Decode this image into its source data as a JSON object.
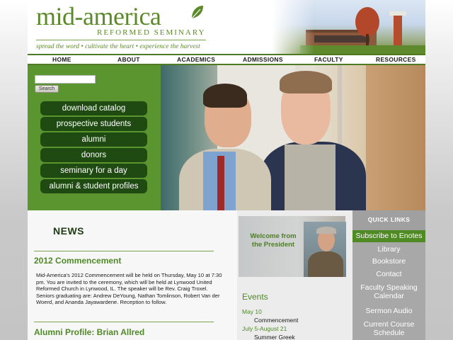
{
  "header": {
    "logo_main": "mid-america",
    "logo_sub": "REFORMED SEMINARY",
    "tagline": "spread the word • cultivate the heart • experience the harvest"
  },
  "nav": {
    "items": [
      {
        "label": "HOME"
      },
      {
        "label": "ABOUT"
      },
      {
        "label": "ACADEMICS"
      },
      {
        "label": "ADMISSIONS"
      },
      {
        "label": "FACULTY"
      },
      {
        "label": "RESOURCES"
      }
    ]
  },
  "search": {
    "value": "",
    "button_label": "Search"
  },
  "quick_buttons": [
    {
      "label": "download catalog"
    },
    {
      "label": "prospective students"
    },
    {
      "label": "alumni"
    },
    {
      "label": "donors"
    },
    {
      "label": "seminary for a day"
    },
    {
      "label": "alumni & student profiles"
    }
  ],
  "news": {
    "title": "NEWS",
    "articles": [
      {
        "title": "2012 Commencement",
        "body": "Mid-America's 2012 Commencement will be held on Thursday, May 10 at 7:30 pm. You are invited to the ceremony, which will be held at Lynwood United Reformed Church in Lynwood, IL. The speaker will be Rev. Craig Troxel. Seniors graduating are: Andrew DeYoung, Nathan Tomlinson, Robert Van der Woerd, and Ananda Jayawardene. Reception to follow."
      },
      {
        "title": "Alumni Profile: Brian Allred",
        "body": ""
      }
    ]
  },
  "president": {
    "welcome_text": "Welcome from the President"
  },
  "events": {
    "title": "Events",
    "items": [
      {
        "date": "May 10",
        "name": "Commencement"
      },
      {
        "date": "July 5-August 21",
        "name": "Summer Greek"
      }
    ]
  },
  "quick_links": {
    "title": "QUICK LINKS",
    "items": [
      {
        "label": "Subscribe to Enotes",
        "active": true
      },
      {
        "label": "Library"
      },
      {
        "label": "Bookstore"
      },
      {
        "label": "Contact"
      },
      {
        "label": "Faculty Speaking Calendar"
      },
      {
        "label": "Sermon Audio"
      },
      {
        "label": "Current Course Schedule"
      }
    ]
  },
  "colors": {
    "brand_green": "#5b9530",
    "dark_green": "#1f4a12",
    "accent_green": "#4f8a24"
  }
}
